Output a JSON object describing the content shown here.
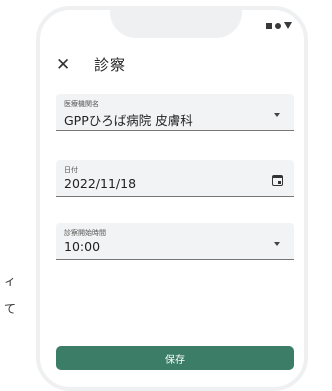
{
  "app_bar": {
    "close_icon": "close-icon",
    "title": "診察"
  },
  "status_bar": {
    "icons": [
      "square-icon",
      "circle-icon",
      "triangle-icon"
    ]
  },
  "form": {
    "hospital": {
      "label": "医療機関名",
      "value": "GPPひろば病院 皮膚科"
    },
    "date": {
      "label": "日付",
      "value": "2022/11/18"
    },
    "start_time": {
      "label": "診察開始時間",
      "value": "10:00"
    }
  },
  "actions": {
    "save_label": "保存"
  },
  "side_fragments": [
    "ィ",
    "て"
  ],
  "colors": {
    "primary": "#3c7d68",
    "field_bg": "#f2f3f4",
    "frame": "#eef0f1"
  }
}
